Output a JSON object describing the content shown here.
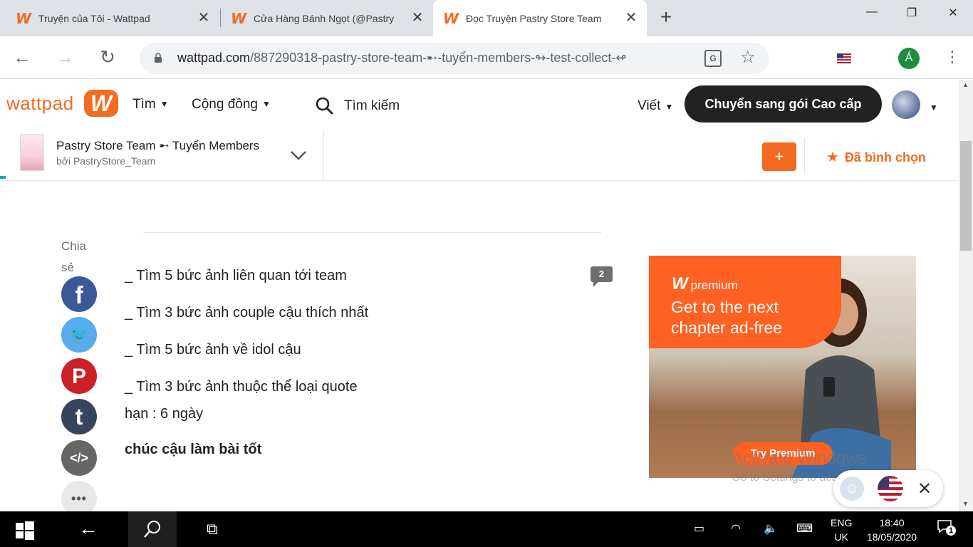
{
  "browser": {
    "tabs": [
      {
        "title": "Truyện của Tôi - Wattpad",
        "active": false
      },
      {
        "title": "Cửa Hàng Bánh Ngọt (@Pastry",
        "active": false
      },
      {
        "title": "Đọc Truyện Pastry Store Team",
        "active": true
      }
    ],
    "favicon_glyph": "W",
    "close_glyph": "✕",
    "new_tab_glyph": "+",
    "window_controls": {
      "minimize": "—",
      "maximize": "❐",
      "close": "✕"
    },
    "url_domain": "wattpad.com",
    "url_path": "/887290318-pastry-store-team-➸-tuyển-members-↬-test-collect-↫",
    "translate_glyph": "G",
    "profile_initial": "Á"
  },
  "header": {
    "logo_text": "wattpad",
    "logo_mark": "W",
    "nav": [
      "Tìm",
      "Cộng đồng"
    ],
    "search_label": "Tìm kiếm",
    "write_label": "Viết",
    "premium_button": "Chuyển sang gói Cao cấp"
  },
  "story": {
    "title": "Pastry Store Team ➸ Tuyển Members",
    "author": "bởi PastryStore_Team",
    "add_button": "+",
    "vote_label": "Đã bình chọn"
  },
  "share": {
    "label": "Chia sẻ",
    "buttons": [
      {
        "name": "facebook",
        "glyph": "f"
      },
      {
        "name": "twitter",
        "glyph": "🐦"
      },
      {
        "name": "pinterest",
        "glyph": "P"
      },
      {
        "name": "tumblr",
        "glyph": "t"
      },
      {
        "name": "embed",
        "glyph": "</>"
      },
      {
        "name": "more",
        "glyph": "•••"
      }
    ]
  },
  "content": {
    "lines": [
      "_ Tìm 5 bức ảnh liên quan tới team",
      "_ Tìm 3 bức ảnh couple cậu thích nhất",
      "_ Tìm 5 bức ảnh về idol cậu",
      "_ Tìm 3 bức ảnh thuộc thể loại quote",
      "hạn : 6 ngày",
      "chúc cậu làm bài tốt"
    ],
    "comment_count": "2"
  },
  "ad": {
    "brand": "premium",
    "brand_mark": "W",
    "headline": "Get to the next chapter ad-free",
    "cta": "Try Premium"
  },
  "watermark": {
    "line1": "Activate Windows",
    "line2": "Go to Settings to activate Windows."
  },
  "toast": {
    "close_glyph": "✕",
    "face_glyph": "☺"
  },
  "taskbar": {
    "lang_line1": "ENG",
    "lang_line2": "UK",
    "time": "18:40",
    "date": "18/05/2020",
    "notifications": "1"
  },
  "colors": {
    "wattpad_orange": "#f26b21",
    "dark_button": "#222222",
    "facebook": "#3b5998",
    "twitter": "#55acee",
    "pinterest": "#cb2027",
    "tumblr": "#35465c"
  }
}
